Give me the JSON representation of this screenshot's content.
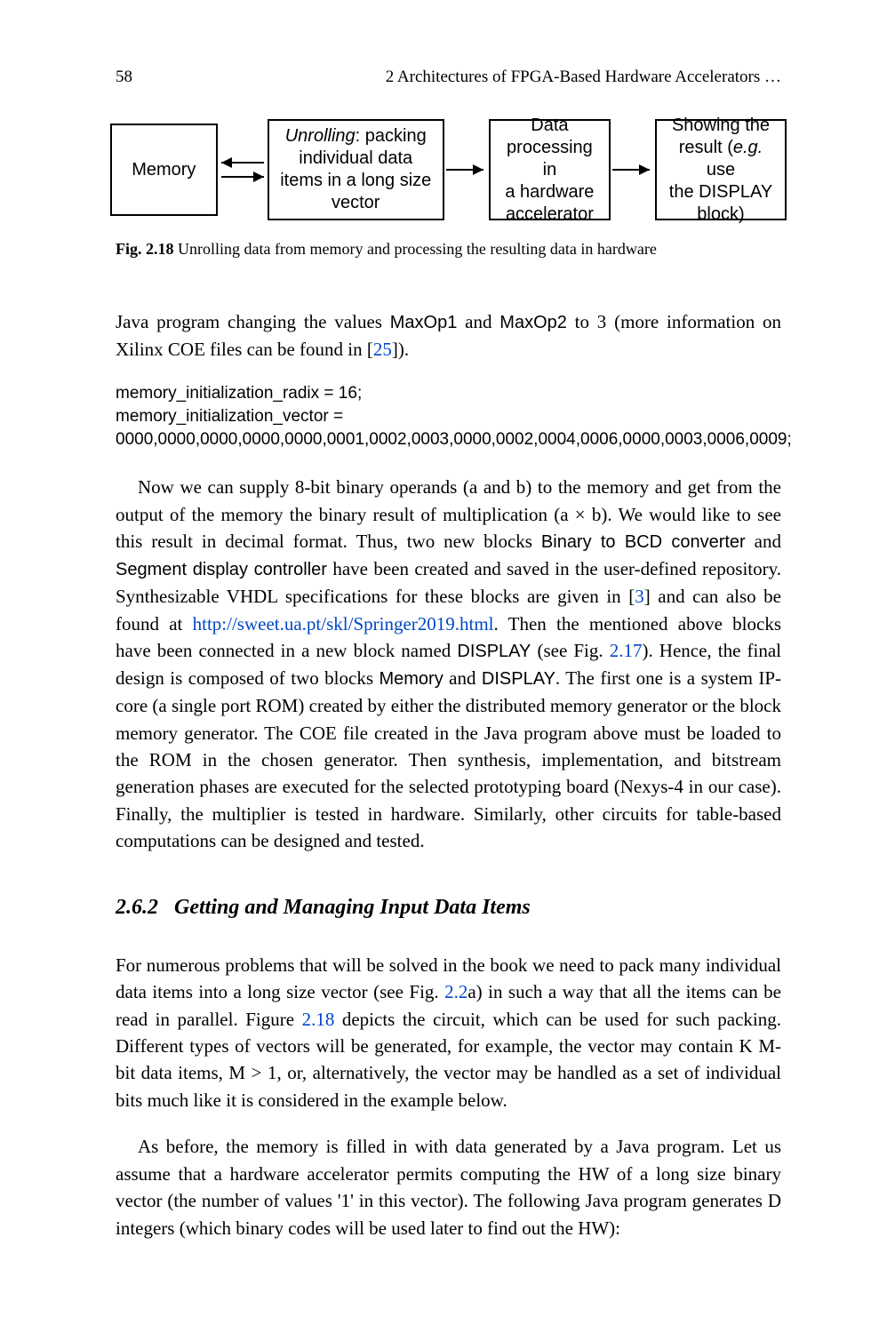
{
  "header": {
    "page_number": "58",
    "running_title": "2   Architectures of FPGA-Based Hardware Accelerators …"
  },
  "figure": {
    "box_memory": "Memory",
    "box_unroll_l1": "Unrolling",
    "box_unroll_l1_tail": ": packing",
    "box_unroll_l2": "individual data",
    "box_unroll_l3": "items in a long size",
    "box_unroll_l4": "vector",
    "box_data_l1": "Data",
    "box_data_l2": "processing in",
    "box_data_l3": "a hardware",
    "box_data_l4": "accelerator",
    "box_show_l1": "Showing the",
    "box_show_l2a": "result (",
    "box_show_l2_eg": "e.g.",
    "box_show_l2b": " use",
    "box_show_l3": "the DISPLAY",
    "box_show_l4": "block)"
  },
  "fig_caption": {
    "label": "Fig. 2.18",
    "text": "   Unrolling data from memory and processing the resulting data in hardware"
  },
  "p1_a": "Java program changing the values ",
  "p1_maxop1": "MaxOp1",
  "p1_and": " and ",
  "p1_maxop2": "MaxOp2",
  "p1_b": " to 3 (more information on Xilinx COE files can be found in [",
  "p1_ref": "25",
  "p1_c": "]).",
  "code_l1": "memory_initialization_radix = 16;",
  "code_l2": "memory_initialization_vector =",
  "code_l3": "0000,0000,0000,0000,0000,0001,0002,0003,0000,0002,0004,0006,0000,0003,0006,0009;",
  "p2_a": "Now we can supply 8-bit binary operands (a and b) to the memory and get from the output of the memory the binary result of multiplication (a × b). We would like to see this result in decimal format. Thus, two new blocks ",
  "p2_b2bcd": "Binary to BCD converter",
  "p2_b": " and ",
  "p2_seg": "Segment display controller",
  "p2_c": " have been created and saved in the user-defined repository. Synthesizable VHDL specifications for these blocks are given in [",
  "p2_ref3": "3",
  "p2_d": "] and can also be found at ",
  "p2_url": "http://sweet.ua.pt/skl/Springer2019.html",
  "p2_e": ". Then the mentioned above blocks have been connected in a new block named ",
  "p2_display": "DISPLAY",
  "p2_f": " (see Fig. ",
  "p2_figref": "2.17",
  "p2_g": "). Hence, the final design is composed of two blocks ",
  "p2_memory": "Memory",
  "p2_h": " and ",
  "p2_display2": "DISPLAY",
  "p2_i": ". The first one is a system IP-core (a single port ROM) created by either the distributed memory generator or the block memory generator. The COE file created in the Java program above must be loaded to the ROM in the chosen generator. Then synthesis, implementation, and bitstream generation phases are executed for the selected prototyping board (Nexys-4 in our case). Finally, the multiplier is tested in hardware. Similarly, other circuits for table-based computations can be designed and tested.",
  "section_num": "2.6.2",
  "section_title": "Getting and Managing Input Data Items",
  "p3_a": "For numerous problems that will be solved in the book we need to pack many individual data items into a long size vector (see Fig. ",
  "p3_figref1": "2.2",
  "p3_b": "a) in such a way that all the items can be read in parallel. Figure ",
  "p3_figref2": "2.18",
  "p3_c": " depicts the circuit, which can be used for such packing. Different types of vectors will be generated, for example, the vector may contain K M-bit data items, M > 1, or, alternatively, the vector may be handled as a set of individual bits much like it is considered in the example below.",
  "p4": "As before, the memory is filled in with data generated by a Java program. Let us assume that a hardware accelerator permits computing the HW of a long size binary vector (the number of values '1' in this vector). The following Java program generates D integers (which binary codes will be used later to find out the HW):"
}
